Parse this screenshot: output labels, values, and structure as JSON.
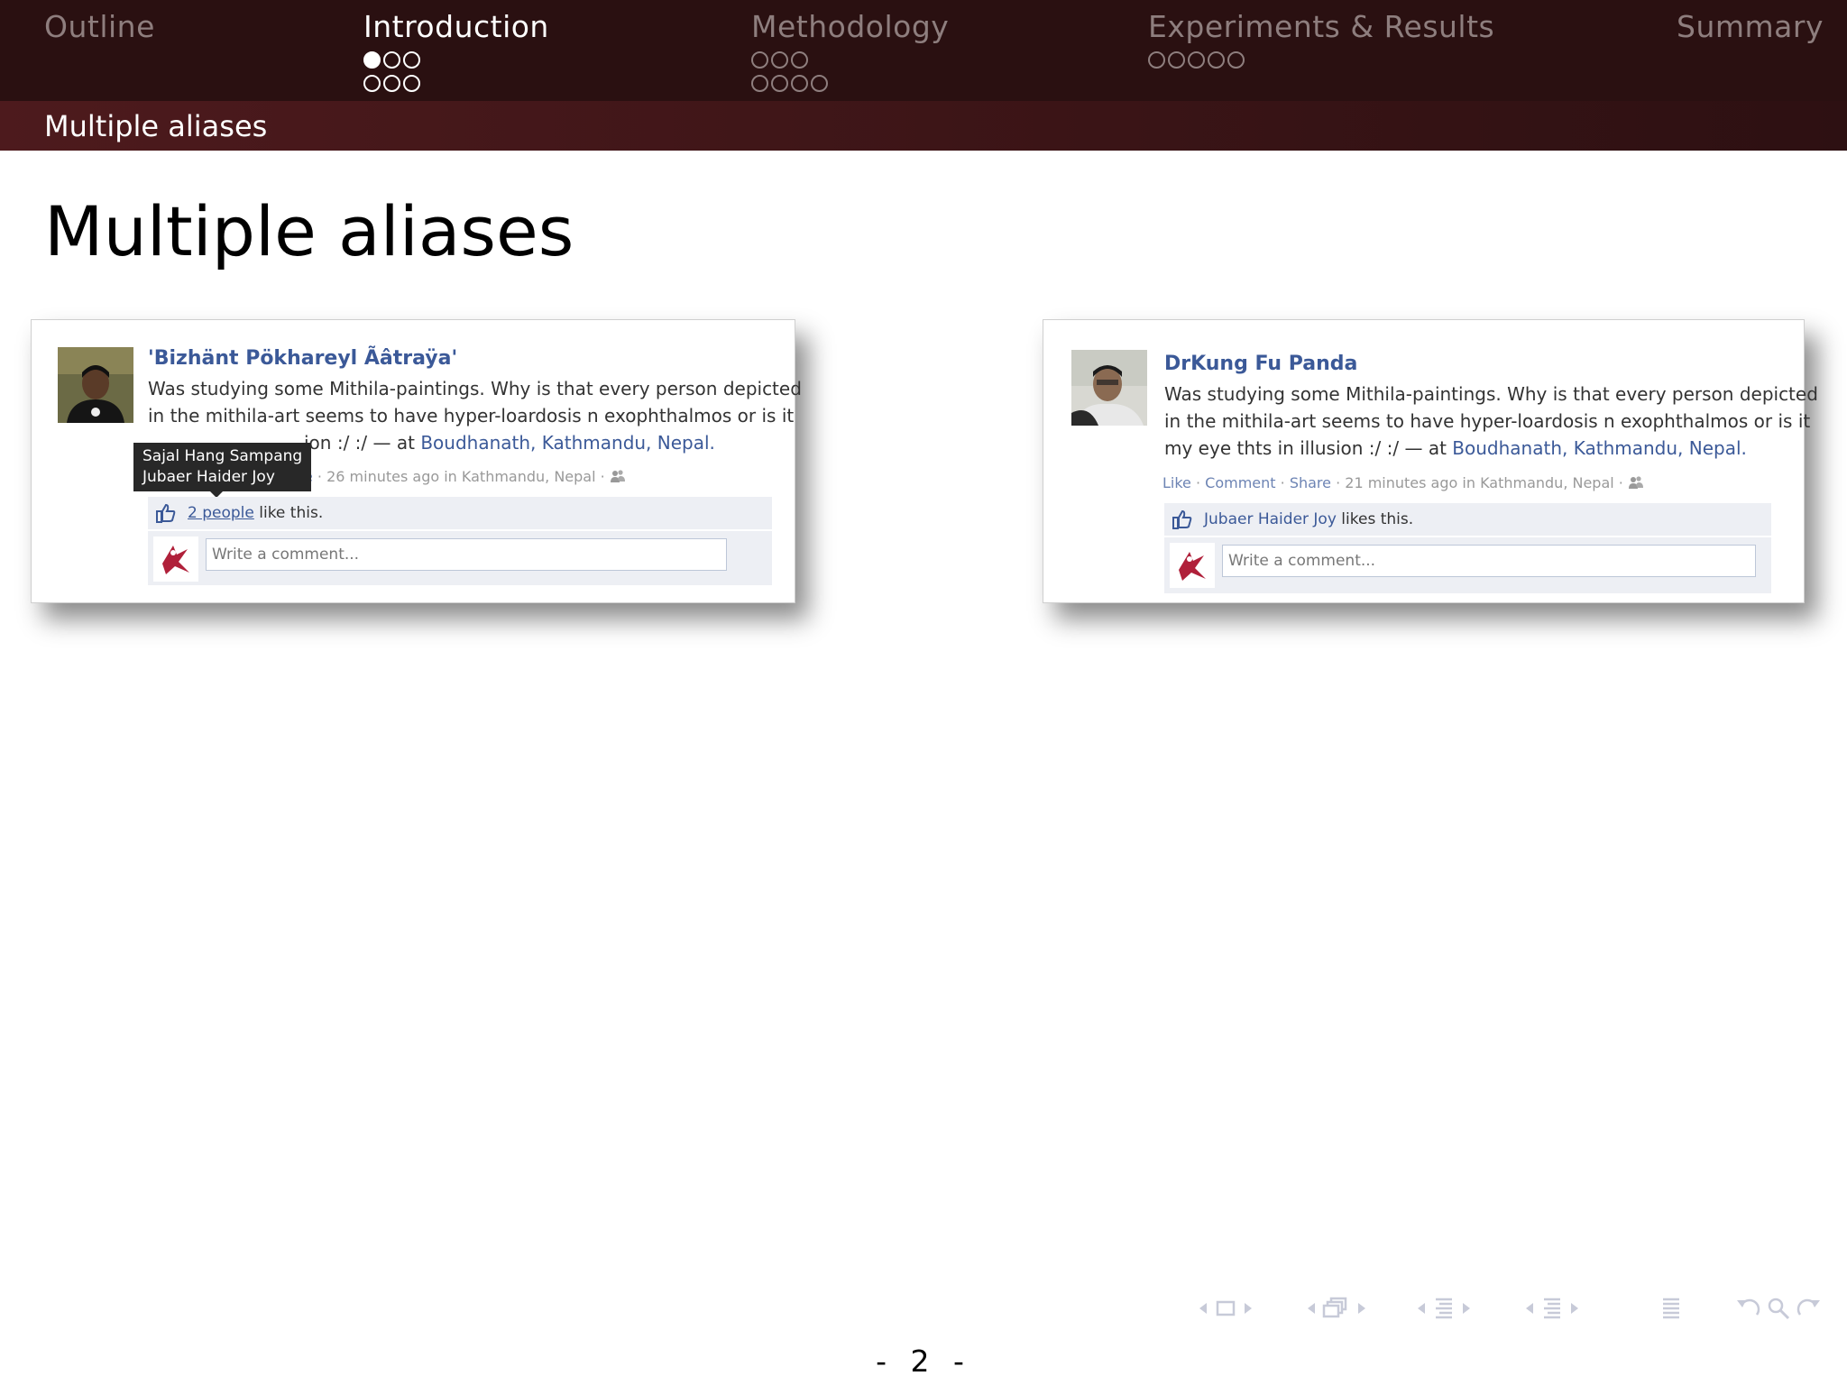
{
  "header": {
    "sections": [
      {
        "title": "Outline",
        "active": false
      },
      {
        "title": "Introduction",
        "active": true
      },
      {
        "title": "Methodology",
        "active": false
      },
      {
        "title": "Experiments & Results",
        "active": false
      },
      {
        "title": "Summary",
        "active": false
      }
    ],
    "subsection_title": "Multiple aliases"
  },
  "slide": {
    "title": "Multiple aliases",
    "page_number": "- 2 -"
  },
  "posts": {
    "left": {
      "author": "'Bizhänt Pökhareyl Ãâtraÿa'",
      "text_line1": "Was studying some Mithila-paintings. Why is that every person depicted",
      "text_line2": "in the mithila-art seems to have hyper-loardosis n exophthalmos or is it",
      "text_line3": "ion :/ :/ — at ",
      "location": "Boudhanath, Kathmandu, Nepal.",
      "meta_link": "e",
      "meta_text": " · 26 minutes ago in Kathmandu, Nepal · ",
      "likes_link": "2 people",
      "likes_text": " like this.",
      "comment_placeholder": "Write a comment...",
      "tooltip_line1": "Sajal Hang Sampang",
      "tooltip_line2": "Jubaer Haider Joy"
    },
    "right": {
      "author": "DrKung Fu Panda",
      "text_line1": "Was studying some Mithila-paintings. Why is that every person depicted",
      "text_line2": "in the mithila-art seems to have hyper-loardosis n exophthalmos or is it",
      "text_line3": "my eye thts in illusion :/ :/ — at ",
      "location": "Boudhanath, Kathmandu, Nepal.",
      "action_like": "Like",
      "action_comment": "Comment",
      "action_share": "Share",
      "meta_text": " · 21 minutes ago in Kathmandu, Nepal · ",
      "likes_link": "Jubaer Haider Joy",
      "likes_text": " likes this.",
      "comment_placeholder": "Write a comment..."
    }
  },
  "icons": {
    "like": "thumbs-up-icon",
    "friends": "friends-icon",
    "nav": [
      "nav-frame-icon",
      "nav-subsection-icon",
      "nav-section-icon",
      "nav-document-icon",
      "nav-back-icon",
      "nav-search-icon",
      "nav-forward-icon"
    ]
  },
  "colors": {
    "header_bg": "#2a1011",
    "subbar_bg": "#4d1a1d",
    "fb_blue": "#3b5998"
  }
}
